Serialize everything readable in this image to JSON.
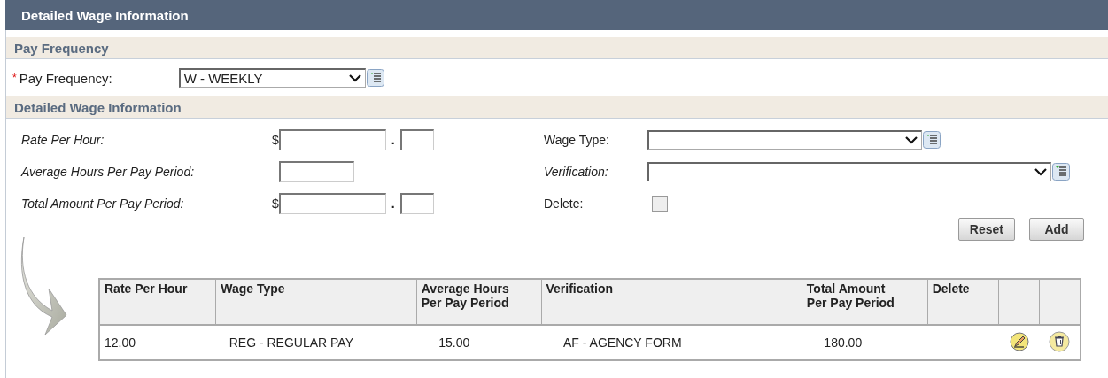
{
  "header": {
    "title": "Detailed Wage Information"
  },
  "pay_frequency_section": {
    "title": "Pay Frequency",
    "label": "Pay Frequency:",
    "required_mark": "*",
    "value": "W - WEEKLY"
  },
  "wage_section": {
    "title": "Detailed Wage Information",
    "left_fields": [
      {
        "label": "Rate Per Hour:",
        "kind": "money",
        "currency": "$",
        "decimal": "."
      },
      {
        "label": "Average Hours Per Pay Period:",
        "kind": "number"
      },
      {
        "label": "Total Amount Per Pay Period:",
        "kind": "money",
        "currency": "$",
        "decimal": "."
      }
    ],
    "right_fields": [
      {
        "label": "Wage Type:",
        "kind": "select",
        "italic": false
      },
      {
        "label": "Verification:",
        "kind": "select",
        "italic": true
      },
      {
        "label": "Delete:",
        "kind": "checkbox",
        "italic": false,
        "checked": false
      }
    ],
    "buttons": [
      "Reset",
      "Add"
    ],
    "table": {
      "columns": [
        "Rate Per Hour",
        "Wage Type",
        "Average Hours Per Pay Period",
        "Verification",
        "Total Amount Per Pay Period",
        "Delete"
      ],
      "rows": [
        {
          "cells": [
            "12.00",
            "REG - REGULAR PAY",
            "15.00",
            "AF - AGENCY FORM",
            "180.00"
          ]
        }
      ]
    }
  }
}
